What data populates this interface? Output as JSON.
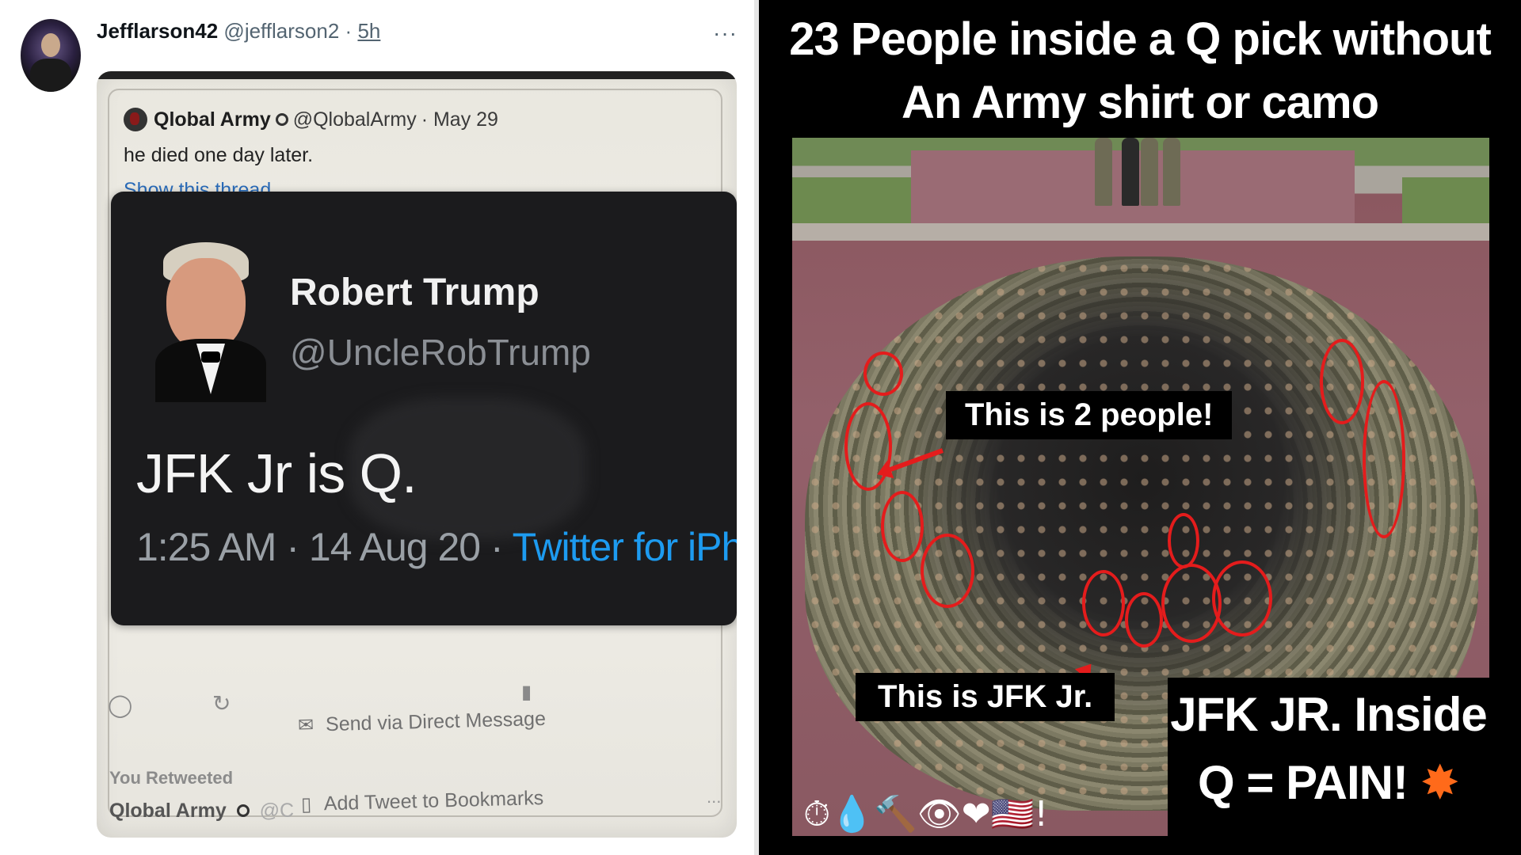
{
  "outer_tweet": {
    "display_name": "Jefflarson42",
    "handle": "@jefflarson2",
    "separator": "·",
    "time": "5h",
    "more": "···"
  },
  "quoted_tweet": {
    "account_name": "Qlobal Army",
    "account_handle": "@QlobalArmy",
    "date": "· May 29",
    "text": "he died one day later.",
    "show_thread": "Show this thread"
  },
  "embedded_tweet": {
    "name": "Robert Trump",
    "handle": "@UncleRobTrump",
    "body": "JFK Jr is Q.",
    "time": "1:25 AM · 14 Aug 20 · ",
    "client": "Twitter for iPhon"
  },
  "tweet_actions": {
    "send_dm": "Send via Direct Message",
    "you_retweeted": "You Retweeted",
    "bottom_account": "Qlobal Army",
    "bottom_handle": "@C",
    "add_bookmark": "Add Tweet to Bookmarks",
    "dots": "..."
  },
  "meme": {
    "title_line1": "23 People inside a Q pick without",
    "title_line2": "An Army shirt or camo",
    "label_two_people": "This is 2 people!",
    "label_jfk": "This is JFK Jr.",
    "bottom_line1": "JFK JR. Inside",
    "bottom_line2": "Q = PAIN!",
    "bottom_emoji": "✸",
    "emoji_row": "⏱💧🔨👁❤🇺🇸!",
    "accent_red": "#e41c1c",
    "client_blue": "#1d9bf0"
  }
}
